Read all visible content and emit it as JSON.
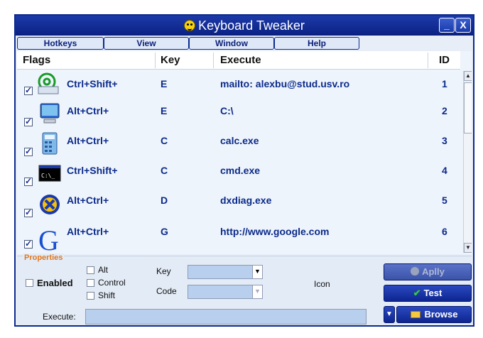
{
  "window": {
    "title": "Keyboard Tweaker"
  },
  "menu": [
    "Hotkeys",
    "View",
    "Window",
    "Help"
  ],
  "columns": {
    "flags": "Flags",
    "key": "Key",
    "execute": "Execute",
    "id": "ID"
  },
  "rows": [
    {
      "icon": "email-icon",
      "modifiers": "Ctrl+Shift+",
      "key": "E",
      "execute": "mailto: alexbu@stud.usv.ro",
      "id": "1",
      "checked": true
    },
    {
      "icon": "computer-icon",
      "modifiers": "Alt+Ctrl+",
      "key": "E",
      "execute": "C:\\",
      "id": "2",
      "checked": true
    },
    {
      "icon": "calculator-icon",
      "modifiers": "Alt+Ctrl+",
      "key": "C",
      "execute": "calc.exe",
      "id": "3",
      "checked": true
    },
    {
      "icon": "console-icon",
      "modifiers": "Ctrl+Shift+",
      "key": "C",
      "execute": "cmd.exe",
      "id": "4",
      "checked": true
    },
    {
      "icon": "dxdiag-icon",
      "modifiers": "Alt+Ctrl+",
      "key": "D",
      "execute": "dxdiag.exe",
      "id": "5",
      "checked": true
    },
    {
      "icon": "google-icon",
      "modifiers": "Alt+Ctrl+",
      "key": "G",
      "execute": "http://www.google.com",
      "id": "6",
      "checked": true
    }
  ],
  "properties": {
    "title": "Properties",
    "enabled_label": "Enabled",
    "alt_label": "Alt",
    "control_label": "Control",
    "shift_label": "Shift",
    "key_label": "Key",
    "code_label": "Code",
    "icon_label": "Icon",
    "execute_label": "Execute:",
    "apply_label": "Aplly",
    "test_label": "Test",
    "browse_label": "Browse"
  }
}
